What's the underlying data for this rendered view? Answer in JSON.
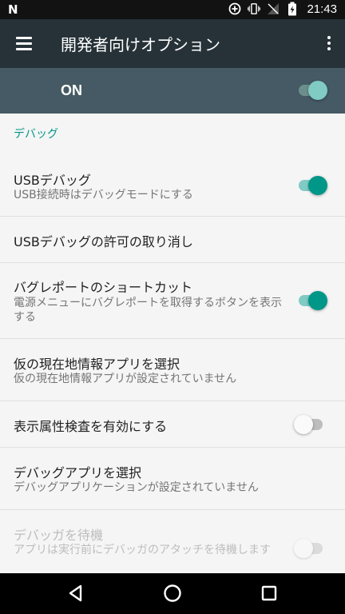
{
  "status_bar": {
    "left_icon": "N",
    "icons": [
      "data-saver-icon",
      "vibrate-icon",
      "no-signal-icon",
      "battery-charging-icon"
    ],
    "time": "21:43"
  },
  "toolbar": {
    "title": "開発者向けオプション",
    "menu_icon": "hamburger-menu-icon",
    "overflow_icon": "more-vert-icon"
  },
  "master": {
    "label": "ON",
    "switch_on": true
  },
  "section": {
    "header": "デバッグ"
  },
  "items": [
    {
      "title": "USBデバッグ",
      "summary": "USB接続時はデバッグモードにする",
      "switch": "on"
    },
    {
      "title": "USBデバッグの許可の取り消し",
      "summary": "",
      "switch": "none"
    },
    {
      "title": "バグレポートのショートカット",
      "summary": "電源メニューにバグレポートを取得するボタンを表示する",
      "switch": "on"
    },
    {
      "title": "仮の現在地情報アプリを選択",
      "summary": "仮の現在地情報アプリが設定されていません",
      "switch": "none"
    },
    {
      "title": "表示属性検査を有効にする",
      "summary": "",
      "switch": "off"
    },
    {
      "title": "デバッグアプリを選択",
      "summary": "デバッグアプリケーションが設定されていません",
      "switch": "none"
    },
    {
      "title": "デバッガを待機",
      "summary": "アプリは実行前にデバッガのアタッチを待機します",
      "switch": "disabled-off"
    }
  ],
  "colors": {
    "accent": "#009688",
    "toolbar": "#263238",
    "master_bar": "#455a64"
  },
  "nav": {
    "back_icon": "back-triangle-icon",
    "home_icon": "home-circle-icon",
    "recents_icon": "recents-square-icon"
  }
}
